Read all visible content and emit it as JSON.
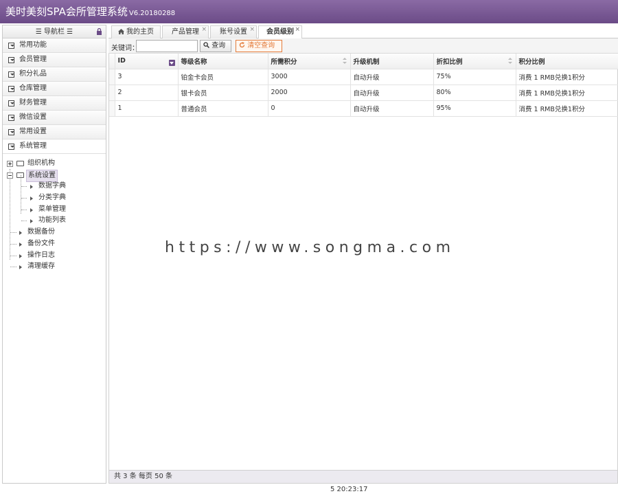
{
  "app": {
    "title": "美时美刻SPA会所管理系统",
    "version": "V6.20180288"
  },
  "nav": {
    "header": "☰ 导航栏 ☰",
    "menu": [
      "常用功能",
      "会员管理",
      "积分礼品",
      "仓库管理",
      "财务管理",
      "微信设置",
      "常用设置",
      "系统管理"
    ],
    "tree": {
      "org": "组织机构",
      "sys_settings": "系统设置",
      "children": [
        "数据字典",
        "分类字典",
        "菜单管理",
        "功能列表"
      ],
      "others": [
        "数据备份",
        "备份文件",
        "操作日志",
        "清理缓存"
      ]
    }
  },
  "tabs": [
    {
      "label": "我的主页",
      "closable": false
    },
    {
      "label": "产品管理",
      "closable": true
    },
    {
      "label": "账号设置",
      "closable": true
    },
    {
      "label": "会员级别",
      "closable": true,
      "active": true
    }
  ],
  "toolbar": {
    "keyword_label": "关键词：",
    "keyword_value": "",
    "search_label": "查询",
    "clear_label": "清空查询"
  },
  "grid": {
    "columns": [
      "ID",
      "等级名称",
      "所需积分",
      "升级机制",
      "折扣比例",
      "积分比例"
    ],
    "rows": [
      {
        "id": "3",
        "name": "铂金卡会员",
        "points": "3000",
        "mechanism": "自动升级",
        "discount": "75%",
        "ratio": "消费 1 RMB兑换1积分"
      },
      {
        "id": "2",
        "name": "银卡会员",
        "points": "2000",
        "mechanism": "自动升级",
        "discount": "80%",
        "ratio": "消费 1 RMB兑换1积分"
      },
      {
        "id": "1",
        "name": "普通会员",
        "points": "0",
        "mechanism": "自动升级",
        "discount": "95%",
        "ratio": "消费 1 RMB兑换1积分"
      }
    ]
  },
  "footer": {
    "summary": "共 3 条 每页 50 条"
  },
  "status": {
    "time": "5 20:23:17"
  },
  "watermark": "https://www.songma.com",
  "colors": {
    "brand": "#6b4b87",
    "clear_button": "#e37b3a"
  },
  "icons": [
    "home-icon",
    "lock-icon",
    "folder-icon",
    "close-icon",
    "search-icon",
    "refresh-icon"
  ]
}
